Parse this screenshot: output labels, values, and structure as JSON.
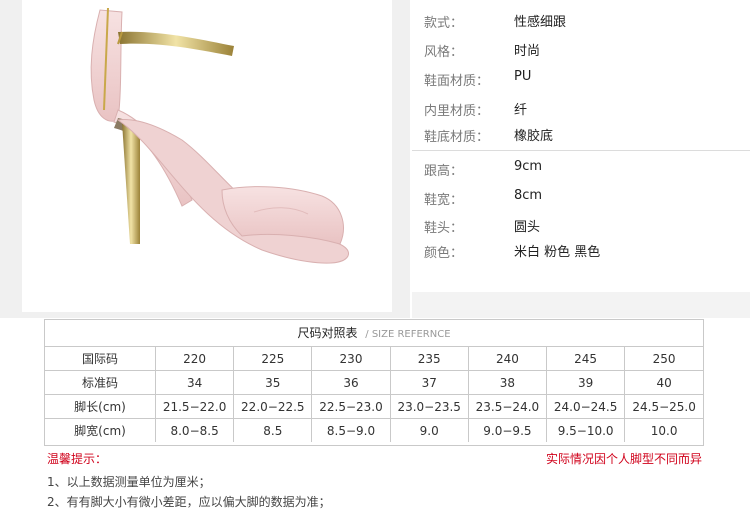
{
  "specs": {
    "group1": [
      {
        "label": "款式：",
        "value": "性感细跟"
      },
      {
        "label": "风格：",
        "value": "时尚"
      },
      {
        "label": "鞋面材质：",
        "value": "PU"
      },
      {
        "label": "内里材质：",
        "value": "纤"
      },
      {
        "label": "鞋底材质：",
        "value": "橡胶底"
      }
    ],
    "group2": [
      {
        "label": "跟高：",
        "value": "9cm"
      },
      {
        "label": "鞋宽：",
        "value": "8cm"
      },
      {
        "label": "鞋头：",
        "value": "圆头"
      },
      {
        "label": "颜色：",
        "value": "米白 粉色 黑色"
      }
    ]
  },
  "size_chart": {
    "title": "尺码对照表",
    "subtitle": "/ SIZE REFERNCE",
    "rows": [
      {
        "label": "国际码",
        "cells": [
          "220",
          "225",
          "230",
          "235",
          "240",
          "245",
          "250"
        ]
      },
      {
        "label": "标准码",
        "cells": [
          "34",
          "35",
          "36",
          "37",
          "38",
          "39",
          "40"
        ]
      },
      {
        "label": "脚长(cm)",
        "cells": [
          "21.5−22.0",
          "22.0−22.5",
          "22.5−23.0",
          "23.0−23.5",
          "23.5−24.0",
          "24.0−24.5",
          "24.5−25.0"
        ]
      },
      {
        "label": "脚宽(cm)",
        "cells": [
          "8.0−8.5",
          "8.5",
          "8.5−9.0",
          "9.0",
          "9.0−9.5",
          "9.5−10.0",
          "10.0"
        ]
      }
    ]
  },
  "tips": {
    "label": "温馨提示：",
    "right_note": "实际情况因个人脚型不同而异",
    "notes": [
      "1、以上数据测量单位为厘米；",
      "2、有有脚大小有微小差距，应以偏大脚的数据为准；"
    ]
  },
  "colors": {
    "shoe_pink": "#f2d6d6",
    "heel_gold": "#c9a84a",
    "accent_red": "#d0021b"
  }
}
